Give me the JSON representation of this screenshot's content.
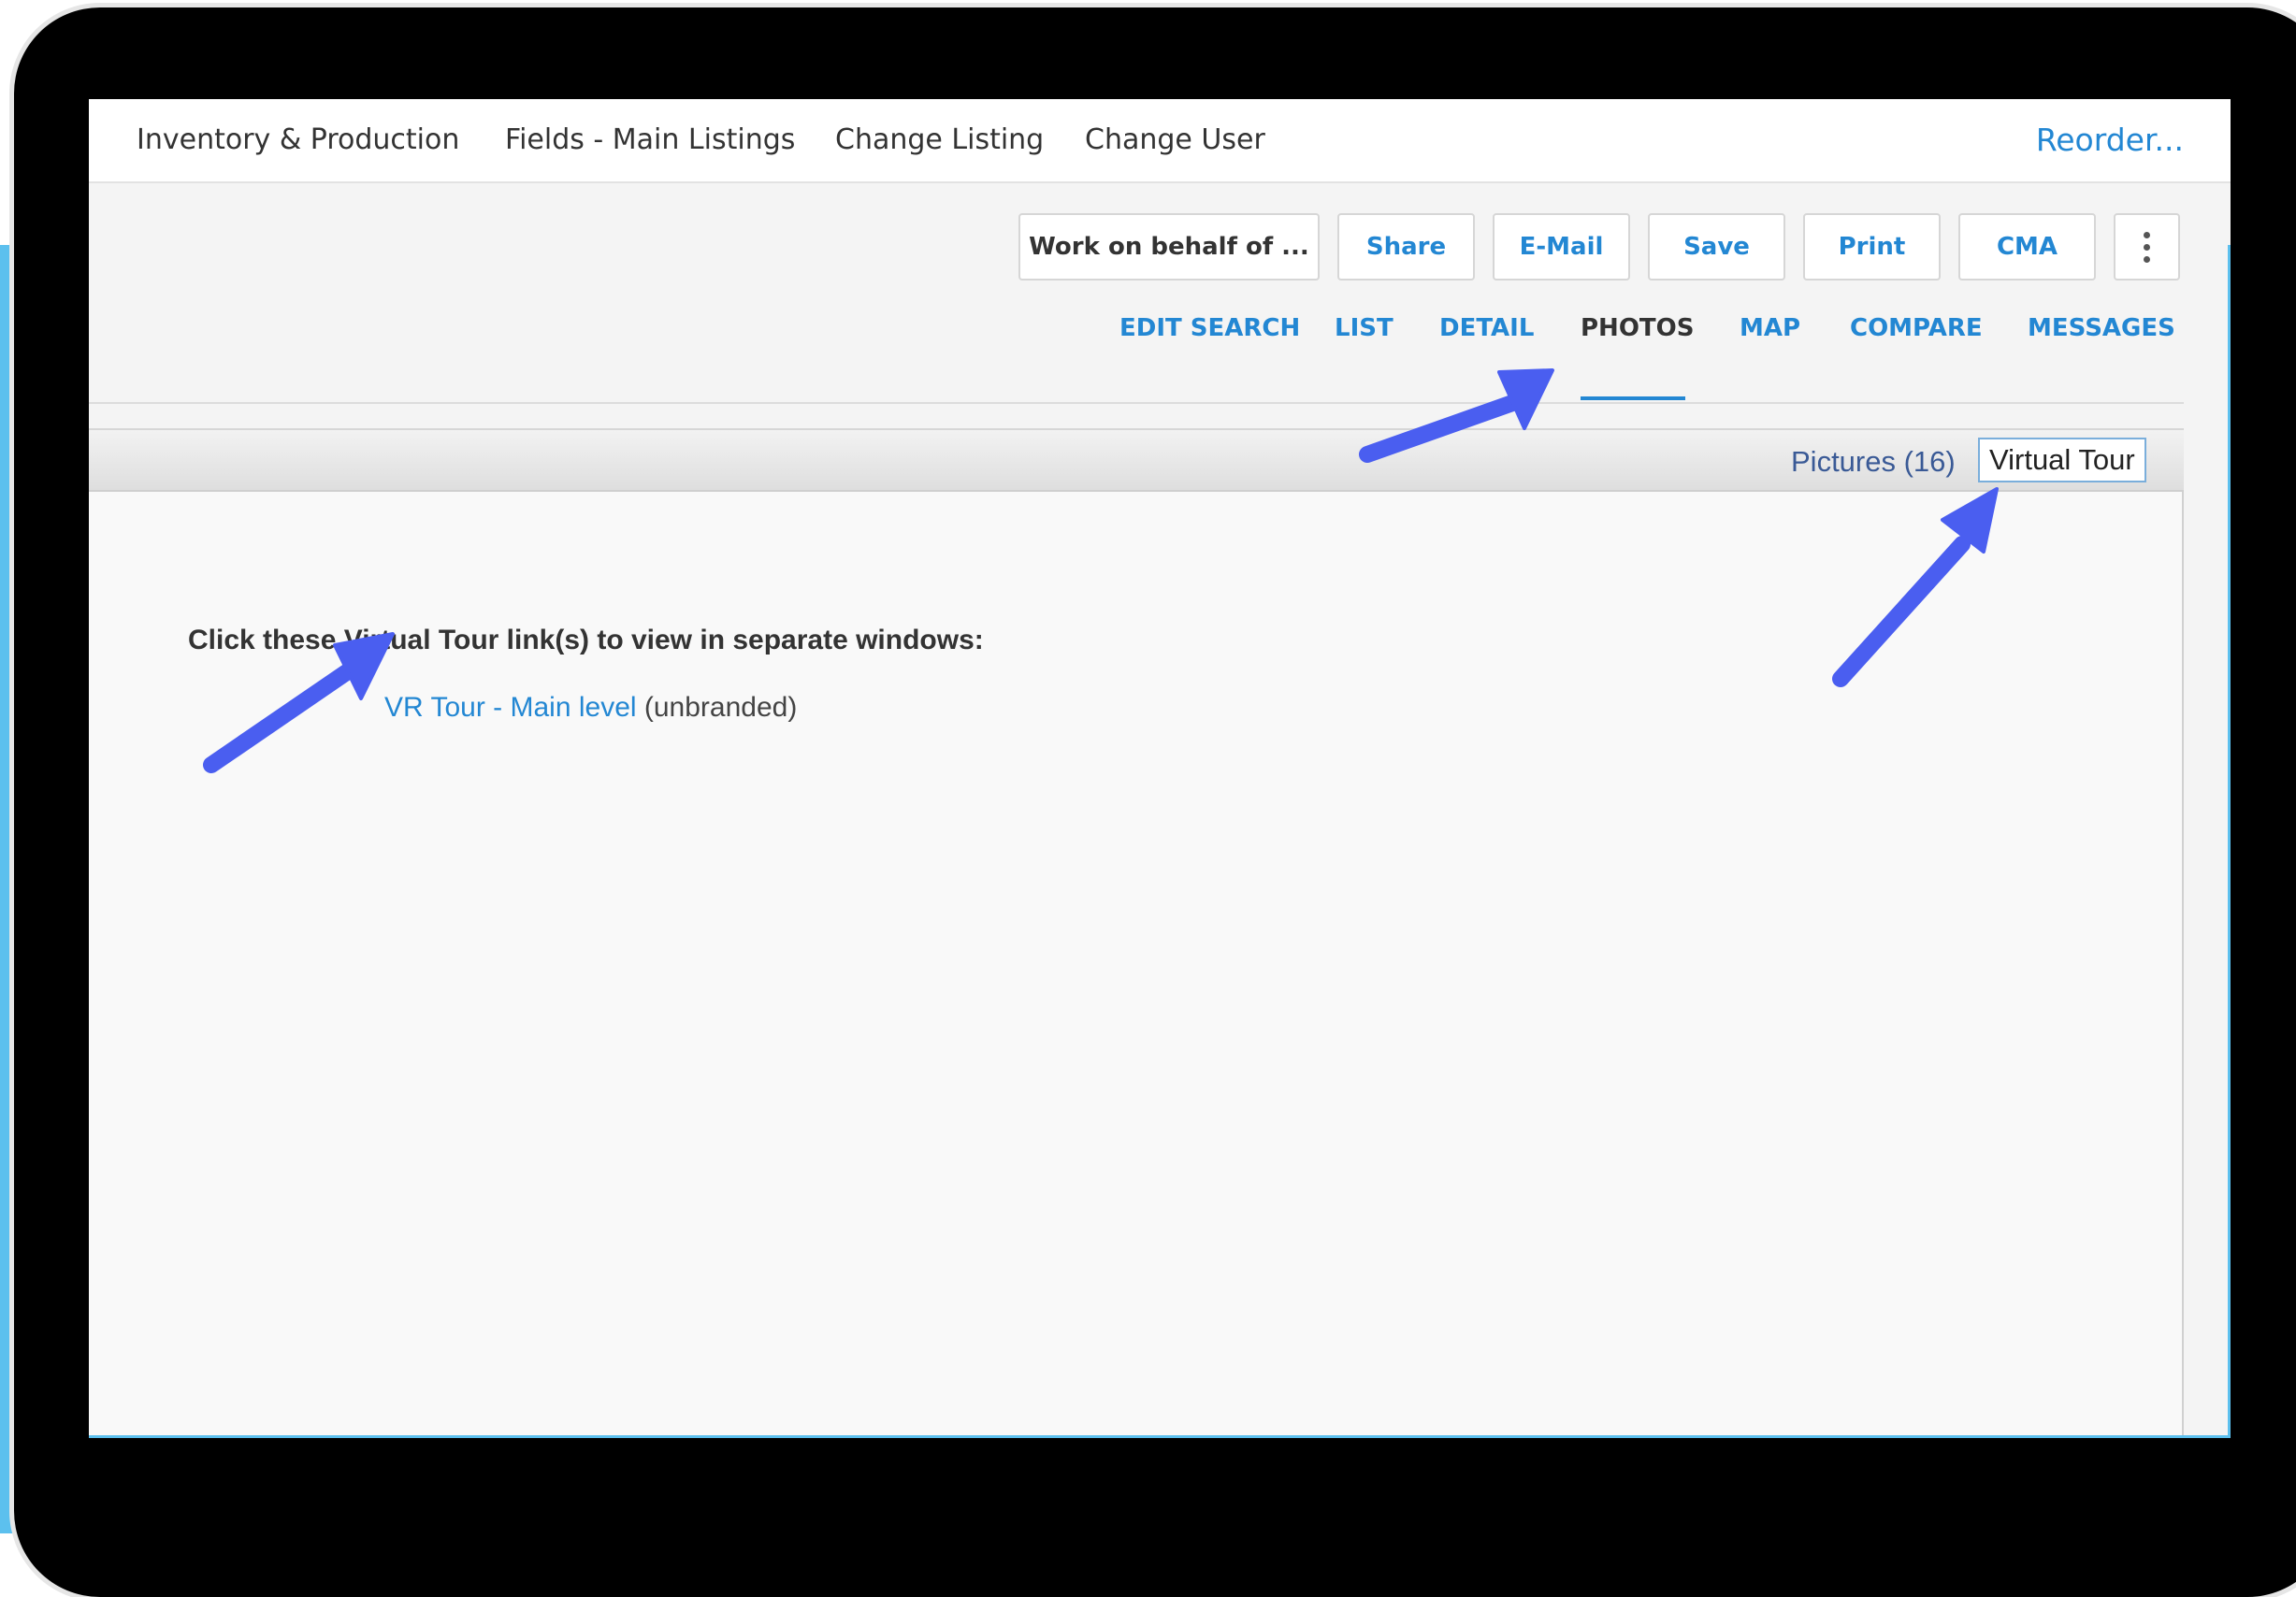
{
  "top_nav": {
    "items": [
      "Inventory & Production",
      "Fields - Main Listings",
      "Change Listing",
      "Change User"
    ],
    "reorder_label": "Reorder..."
  },
  "toolbar": {
    "work_on_behalf": "Work on behalf of ...",
    "share": "Share",
    "email": "E-Mail",
    "save": "Save",
    "print": "Print",
    "cma": "CMA",
    "more_icon": "kebab-vertical-icon"
  },
  "tabs": {
    "items": [
      "EDIT SEARCH",
      "LIST",
      "DETAIL",
      "PHOTOS",
      "MAP",
      "COMPARE",
      "MESSAGES"
    ],
    "active": "PHOTOS"
  },
  "photo_panel": {
    "pictures_label": "Pictures (16)",
    "virtual_tour_label": "Virtual Tour",
    "instruction": "Click these Virtual Tour link(s) to view in separate windows:",
    "tour_link": "VR Tour - Main level",
    "tour_note": " (unbranded)"
  },
  "colors": {
    "accent": "#2387d3",
    "annotation_arrow": "#4a5ef0",
    "backdrop": "#5cc0ee"
  }
}
